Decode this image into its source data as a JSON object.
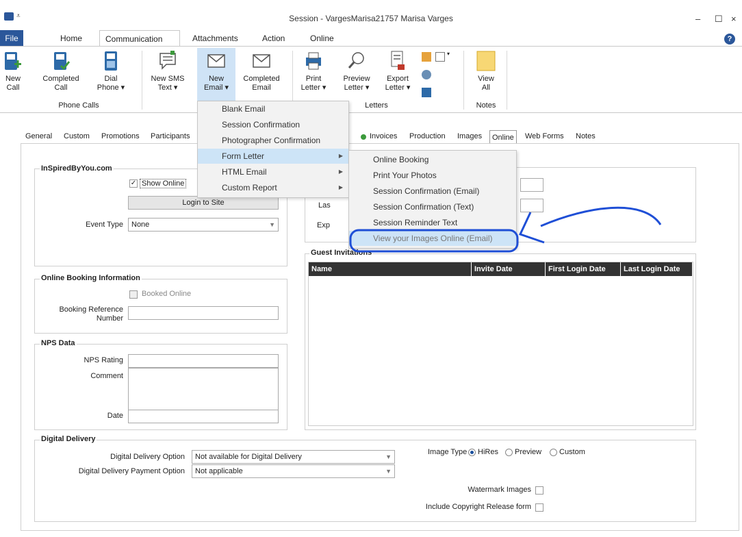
{
  "window": {
    "title": "Session - VargesMarisa21757 Marisa Varges",
    "minimize": "–",
    "maximize": "☐",
    "close": "×"
  },
  "ribbon_tabs": [
    "File",
    "Home",
    "Communication",
    "Attachments",
    "Action",
    "Online"
  ],
  "ribbon": {
    "phone_group_label": "Phone Calls",
    "letters_group_label": "Letters",
    "notes_group_label": "Notes",
    "new_call": "New\nCall",
    "completed_call": "Completed\nCall",
    "dial_phone": "Dial\nPhone ▾",
    "new_sms": "New SMS\nText ▾",
    "new_email": "New\nEmail ▾",
    "completed_email": "Completed\nEmail",
    "print_letter": "Print\nLetter ▾",
    "preview_letter": "Preview\nLetter ▾",
    "export_letter": "Export\nLetter ▾",
    "view_all": "View\nAll"
  },
  "content_tabs": [
    "General",
    "Custom",
    "Promotions",
    "Participants",
    "Invoices",
    "Production",
    "Images",
    "Online",
    "Web Forms",
    "Notes"
  ],
  "email_menu": [
    "Blank Email",
    "Session Confirmation",
    "Photographer Confirmation",
    "Form Letter",
    "HTML Email",
    "Custom Report"
  ],
  "form_letter_menu": [
    "Online Booking",
    "Print Your Photos",
    "Session Confirmation (Email)",
    "Session Confirmation (Text)",
    "Session Reminder Text",
    "View your Images Online (Email)"
  ],
  "inspired": {
    "legend": "InSpiredByYou.com",
    "show_online": "Show Online",
    "login_button": "Login to Site",
    "event_type_label": "Event Type",
    "event_type_value": "None"
  },
  "right_panel": {
    "last_label": "Las",
    "exp_label": "Exp"
  },
  "booking": {
    "legend": "Online Booking Information",
    "booked_online": "Booked Online",
    "ref_label_1": "Booking Reference",
    "ref_label_2": "Number"
  },
  "nps": {
    "legend": "NPS Data",
    "rating": "NPS Rating",
    "comment": "Comment",
    "date": "Date"
  },
  "guest": {
    "legend": "Guest Invitations",
    "columns": [
      "Name",
      "Invite Date",
      "First Login Date",
      "Last Login Date"
    ]
  },
  "digital": {
    "legend": "Digital Delivery",
    "option_label": "Digital Delivery Option",
    "option_value": "Not available for Digital Delivery",
    "payment_label": "Digital Delivery Payment Option",
    "payment_value": "Not applicable",
    "image_type_label": "Image Type",
    "hires": "HiRes",
    "preview": "Preview",
    "custom": "Custom",
    "watermark": "Watermark Images",
    "copyright": "Include Copyright Release form"
  },
  "colors": {
    "accent": "#2b579a",
    "annotation": "#1f4fd6",
    "menu_hover": "#cde4f7"
  }
}
